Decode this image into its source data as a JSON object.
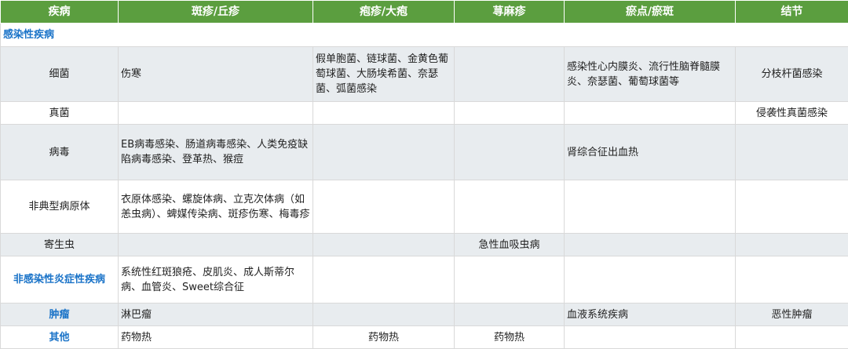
{
  "headers": [
    "疾病",
    "斑疹/丘疹",
    "疱疹/大疱",
    "荨麻疹",
    "瘀点/瘀斑",
    "结节"
  ],
  "section_infectious": "感染性疾病",
  "rows": [
    {
      "name": "细菌",
      "c1": "伤寒",
      "c2": "假单胞菌、链球菌、金黄色葡萄球菌、大肠埃希菌、奈瑟菌、弧菌感染",
      "c3": "",
      "c4": "感染性心内膜炎、流行性脑脊髓膜炎、奈瑟菌、葡萄球菌等",
      "c5": "分枝杆菌感染"
    },
    {
      "name": "真菌",
      "c1": "",
      "c2": "",
      "c3": "",
      "c4": "",
      "c5": "侵袭性真菌感染"
    },
    {
      "name": "病毒",
      "c1": "EB病毒感染、肠道病毒感染、人类免疫缺陷病毒感染、登革热、猴痘",
      "c2": "",
      "c3": "",
      "c4": "肾综合征出血热",
      "c5": ""
    },
    {
      "name": "非典型病原体",
      "c1": "衣原体感染、螺旋体病、立克次体病（如恙虫病）、蜱媒传染病、斑疹伤寒、梅毒疹",
      "c2": "",
      "c3": "",
      "c4": "",
      "c5": ""
    },
    {
      "name": "寄生虫",
      "c1": "",
      "c2": "",
      "c3": "急性血吸虫病",
      "c4": "",
      "c5": ""
    },
    {
      "name": "非感染性炎症性疾病",
      "c1": "系统性红斑狼疮、皮肌炎、成人斯蒂尔病、血管炎、Sweet综合征",
      "c2": "",
      "c3": "",
      "c4": "",
      "c5": ""
    },
    {
      "name": "肿瘤",
      "c1": "淋巴瘤",
      "c2": "",
      "c3": "",
      "c4": "血液系统疾病",
      "c5": "恶性肿瘤"
    },
    {
      "name": "其他",
      "c1": "药物热",
      "c2": "药物热",
      "c3": "药物热",
      "c4": "",
      "c5": ""
    }
  ]
}
